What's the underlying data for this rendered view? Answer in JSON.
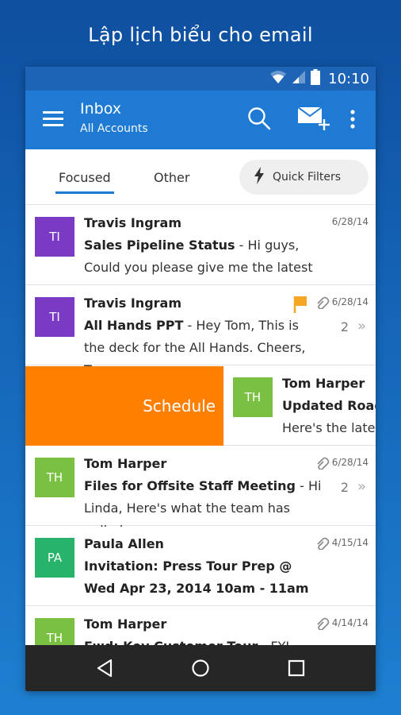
{
  "caption": "Lập lịch biểu cho email",
  "status_bar": {
    "time": "10:10"
  },
  "app_bar": {
    "title": "Inbox",
    "subtitle": "All Accounts"
  },
  "tabs": [
    {
      "label": "Focused",
      "active": true
    },
    {
      "label": "Other",
      "active": false
    }
  ],
  "quick_filters_label": "Quick Filters",
  "swipe_action_label": "Schedule",
  "messages": [
    {
      "initials": "TI",
      "avatar_color": "#7b3ac3",
      "sender": "Travis Ingram",
      "subject": "Sales Pipeline Status",
      "preview": " - Hi guys, Could you please give me the latest on",
      "date": "6/28/14"
    },
    {
      "initials": "TI",
      "avatar_color": "#7b3ac3",
      "sender": "Travis Ingram",
      "subject": "All Hands PPT",
      "preview": " - Hey Tom, This is the deck for the All Hands. Cheers, Tom",
      "date": "6/28/14",
      "count": "2",
      "flagged": true,
      "attachment": true
    },
    {
      "initials": "TH",
      "avatar_color": "#7ac143",
      "sender": "Tom Harper",
      "subject": "Updated Roadmap",
      "preview": "Here's the latest",
      "date": ""
    },
    {
      "initials": "TH",
      "avatar_color": "#7ac143",
      "sender": "Tom Harper",
      "subject": "Files for Offsite Staff Meeting",
      "preview": " - Hi Linda, Here's what the team has pulled",
      "date": "6/28/14",
      "count": "2",
      "attachment": true
    },
    {
      "initials": "PA",
      "avatar_color": "#27b36a",
      "sender": "Paula Allen",
      "subject": "Invitation: Press Tour Prep @ Wed Apr 23, 2014 10am - 11am",
      "preview": "",
      "date": "4/15/14",
      "attachment": true
    },
    {
      "initials": "TH",
      "avatar_color": "#7ac143",
      "sender": "Tom Harper",
      "subject": "Fwd: Key Customer Tour",
      "preview": " - FYI. Docs",
      "date": "4/14/14",
      "attachment": true
    }
  ],
  "colors": {
    "accent": "#1f7ad4",
    "status_bar": "#1d64b6",
    "swipe": "#ff8000",
    "flag": "#f5a623",
    "nav_bar": "#262626"
  },
  "icons": [
    "wifi-icon",
    "signal-icon",
    "battery-icon",
    "menu-icon",
    "search-icon",
    "compose-icon",
    "more-icon",
    "lightning-icon",
    "attachment-icon",
    "flag-icon",
    "chevron-double-icon",
    "back-icon",
    "home-icon",
    "recents-icon"
  ]
}
